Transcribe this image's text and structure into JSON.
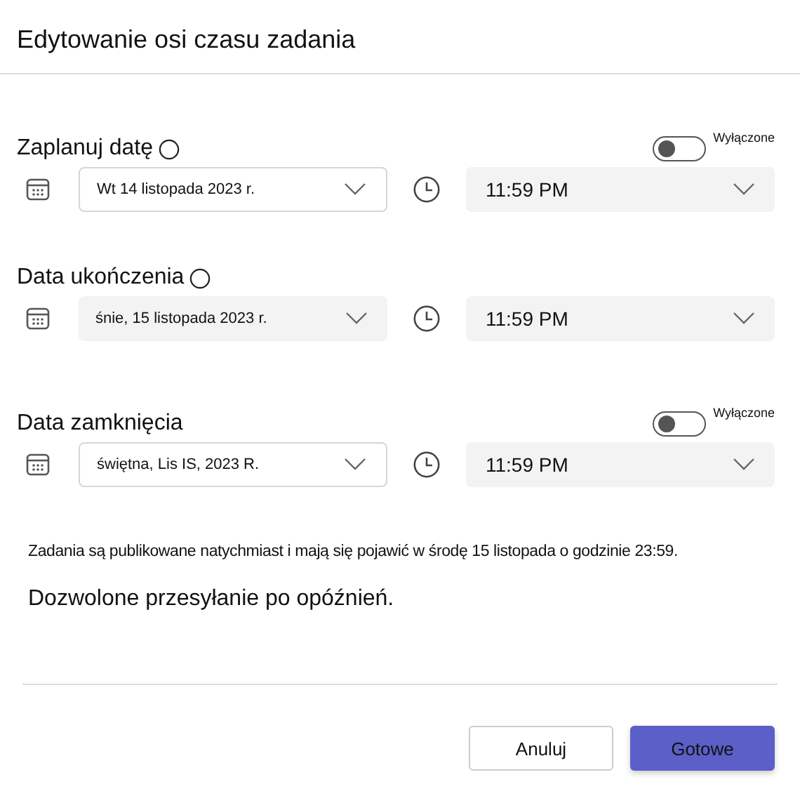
{
  "dialog": {
    "title": "Edytowanie osi czasu zadania"
  },
  "rows": [
    {
      "label": "Zaplanuj datę",
      "info": true,
      "toggle": {
        "label": "Wyłączone",
        "on": false
      },
      "date": "Wt 14 listopada 2023 r.",
      "time": "11:59 PM"
    },
    {
      "label": "Data ukończenia",
      "info": true,
      "date": "śnie, 15 listopada 2023 r.",
      "time": "11:59 PM"
    },
    {
      "label": "Data zamknięcia",
      "info": false,
      "toggle": {
        "label": "Wyłączone",
        "on": false
      },
      "date": "świętna, Lis IS, 2023 R.",
      "time": "11:59 PM"
    }
  ],
  "message": "Zadania są publikowane natychmiast i mają się pojawić w środę 15 listopada o godzinie 23:59.",
  "late_submission": "Dozwolone przesyłanie po opóźnień.",
  "buttons": [
    {
      "label": "Anuluj",
      "kind": "secondary"
    },
    {
      "label": "Gotowe",
      "kind": "primary"
    }
  ]
}
